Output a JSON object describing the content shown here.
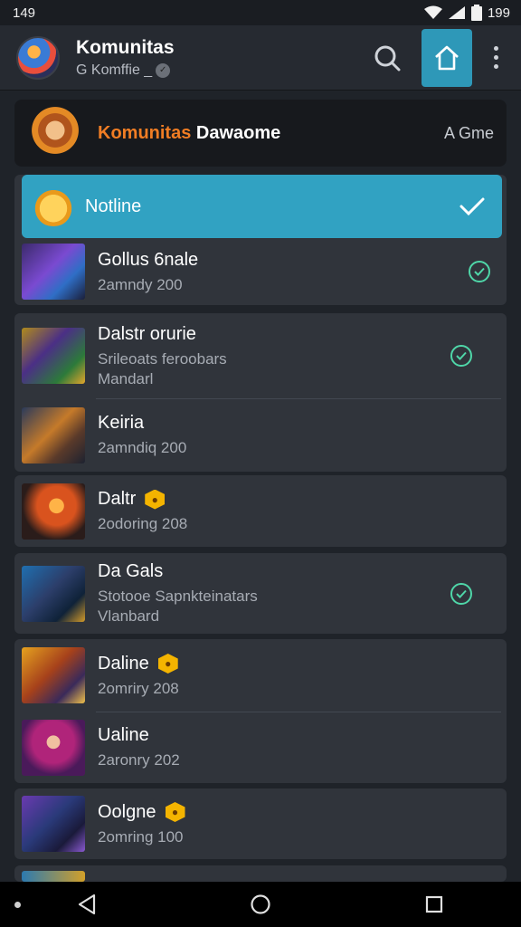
{
  "status_bar": {
    "time": "149",
    "battery": "199"
  },
  "app_bar": {
    "title": "Komunitas",
    "subtitle": "G Komffie _",
    "icons": [
      "search-icon",
      "home-icon",
      "more-vertical-icon"
    ]
  },
  "community": {
    "name_accent": "Komunitas",
    "name_rest": " Dawaome",
    "tag": "A Gme"
  },
  "selected": {
    "label": "Notline"
  },
  "groups": [
    {
      "rows": [
        {
          "title": "Gollus 6nale",
          "sub": "2amndy 200",
          "sub2": "",
          "status": "check"
        }
      ]
    },
    {
      "rows": [
        {
          "title": "Dalstr orurie",
          "sub": "Srileoats feroobars",
          "sub2": "Mandarl",
          "status": "check"
        },
        {
          "title": "Keiria",
          "sub": "2amndiq 200",
          "sub2": "",
          "status": ""
        }
      ]
    },
    {
      "rows": [
        {
          "title": "Daltr",
          "sub": "2odoring 208",
          "sub2": "",
          "status": "badge"
        }
      ]
    },
    {
      "rows": [
        {
          "title": "Da Gals",
          "sub": "Stotooe Sapnkteinatars",
          "sub2": "Vlanbard",
          "status": "check"
        }
      ]
    },
    {
      "rows": [
        {
          "title": "Daline",
          "sub": "2omriry 208",
          "sub2": "",
          "status": "badge"
        },
        {
          "title": "Ualine",
          "sub": "2aronry 202",
          "sub2": "",
          "status": ""
        }
      ]
    },
    {
      "rows": [
        {
          "title": "Oolgne",
          "sub": "2omring 100",
          "sub2": "",
          "status": "badge"
        }
      ]
    }
  ],
  "colors": {
    "accent_teal": "#31a2c2",
    "accent_orange": "#f07d24",
    "check_green": "#4fd6a8",
    "badge_gold": "#f4b400"
  }
}
